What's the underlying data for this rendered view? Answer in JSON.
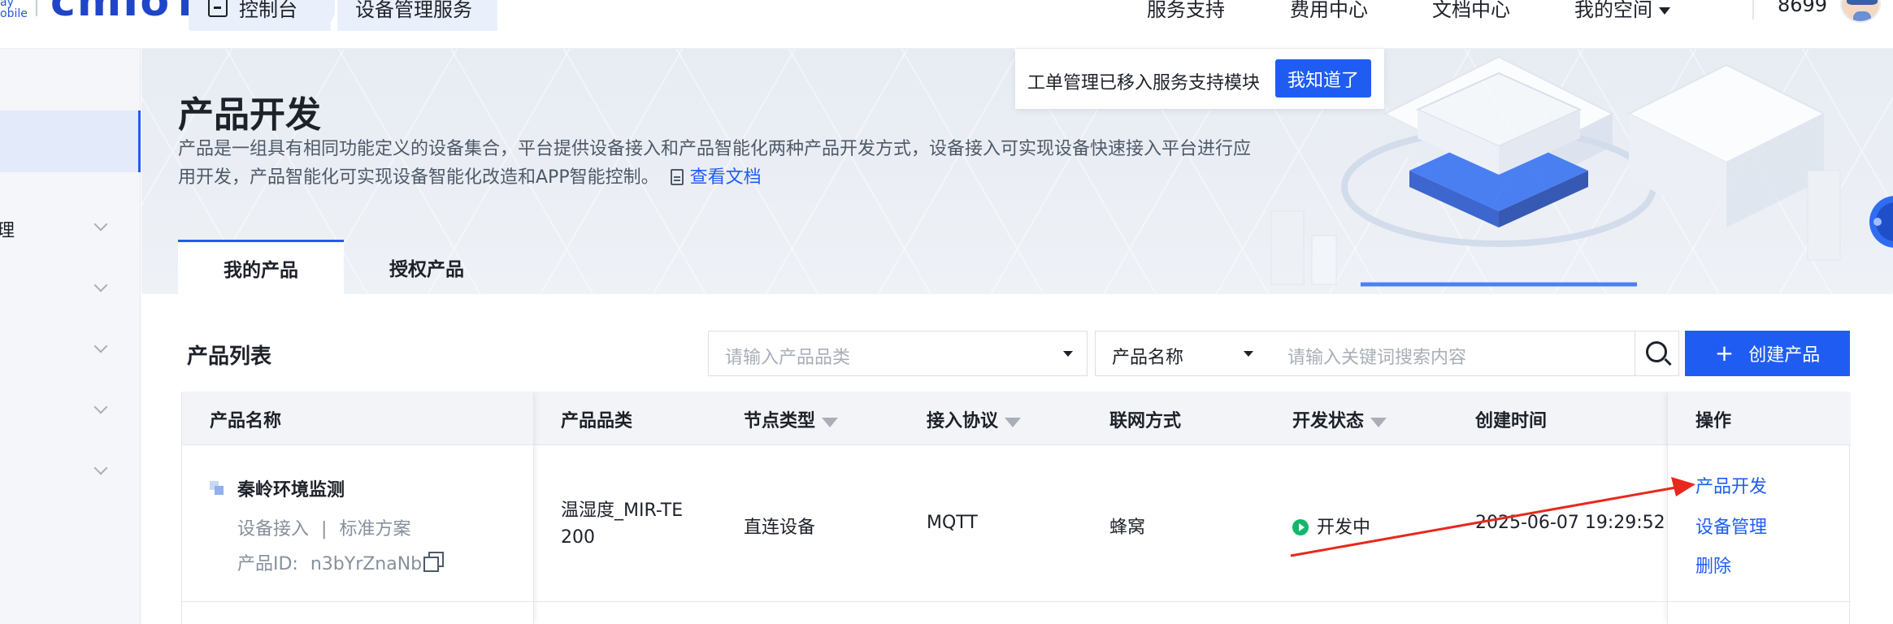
{
  "topnav": {
    "logo_sub_line1": "ay",
    "logo_sub_line2": "obile",
    "logo_text": "cmIoT",
    "breadcrumb": [
      "控制台",
      "设备管理服务"
    ],
    "links": [
      "服务支持",
      "费用中心",
      "文档中心",
      "我的空间"
    ],
    "user_name": "8699"
  },
  "sidebar": {
    "items": [
      {
        "label": ""
      },
      {
        "label": "理"
      },
      {
        "label": ""
      },
      {
        "label": ""
      },
      {
        "label": ""
      },
      {
        "label": ""
      }
    ]
  },
  "header": {
    "title": "产品开发",
    "description_line1": "产品是一组具有相同功能定义的设备集合，平台提供设备接入和产品智能化两种产品开发方式，设备接入可实现设备快速接入平台进行应",
    "description_line2": "用开发，产品智能化可实现设备智能化改造和APP智能控制。",
    "doc_link": "查看文档"
  },
  "notice": {
    "text": "工单管理已移入服务支持模块",
    "button": "我知道了"
  },
  "tabs": [
    "我的产品",
    "授权产品"
  ],
  "toolbar": {
    "list_title": "产品列表",
    "category_placeholder": "请输入产品品类",
    "search_field": "产品名称",
    "search_placeholder": "请输入关键词搜索内容",
    "create_label": "创建产品",
    "create_plus": "+"
  },
  "table": {
    "columns": [
      "产品名称",
      "产品品类",
      "节点类型",
      "接入协议",
      "联网方式",
      "开发状态",
      "创建时间",
      "操作"
    ],
    "rows": [
      {
        "name": "秦岭环境监测",
        "access": "设备接入",
        "sep": "|",
        "scheme": "标准方案",
        "id_label": "产品ID:",
        "id_value": "n3bYrZnaNb",
        "category_line1": "温湿度_MIR-TE",
        "category_line2": "200",
        "node_type": "直连设备",
        "protocol": "MQTT",
        "network": "蜂窝",
        "status": "开发中",
        "created": "2025-06-07 19:29:52",
        "actions": [
          "产品开发",
          "设备管理",
          "删除"
        ]
      }
    ]
  },
  "colors": {
    "primary": "#1f5df2",
    "status_green": "#12b76a",
    "annotation_red": "#e8281d"
  }
}
